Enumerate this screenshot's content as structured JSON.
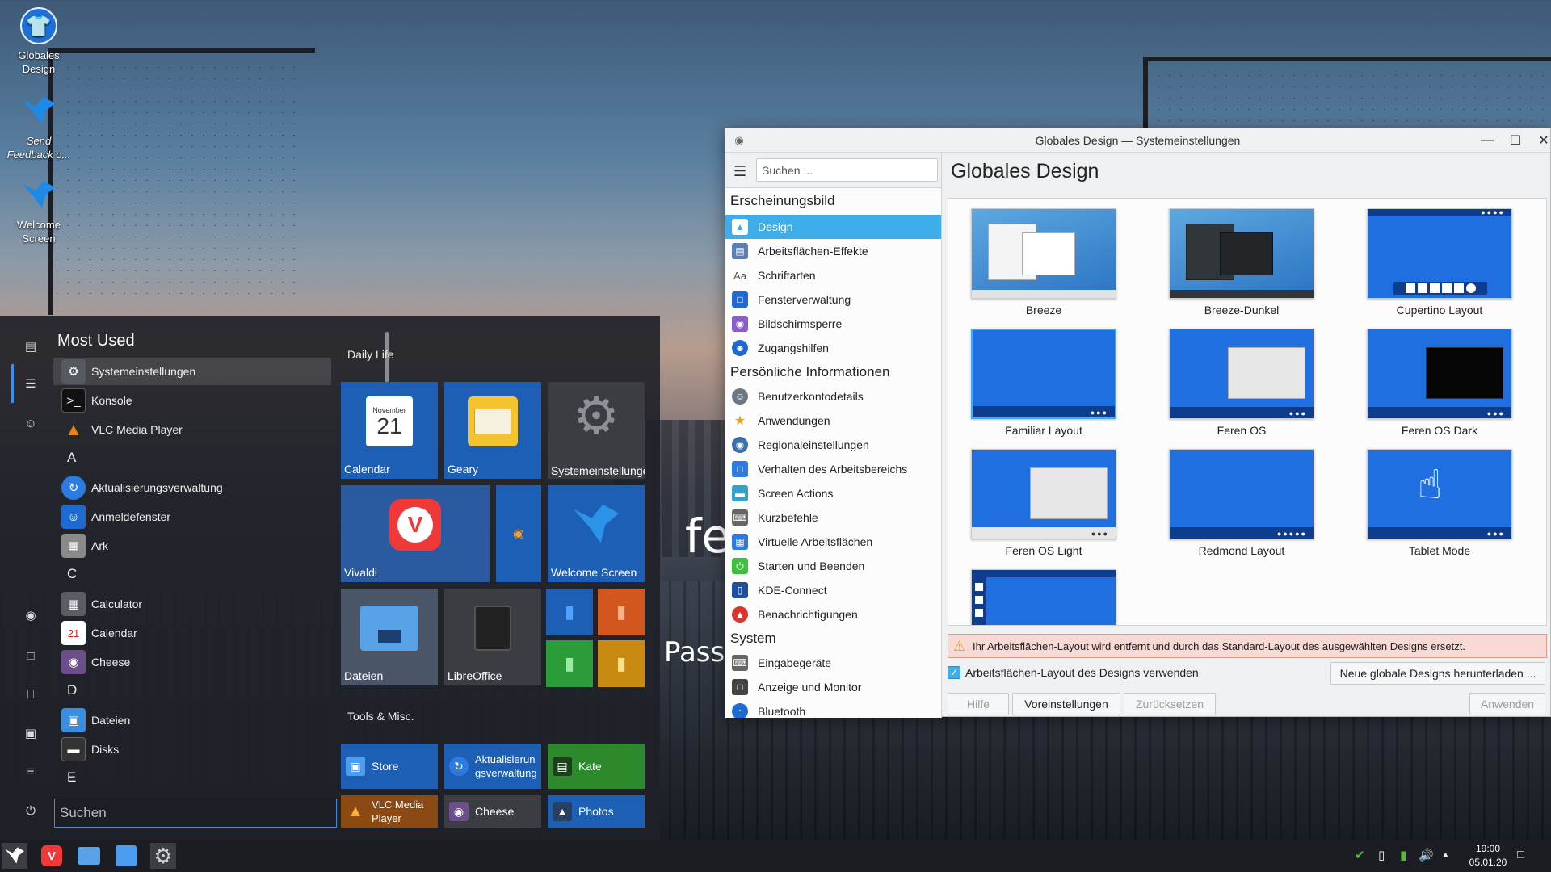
{
  "desktop": {
    "icons": [
      {
        "label": "Globales Design",
        "icon": "tshirt-icon"
      },
      {
        "label": "Send Feedback o...",
        "icon": "feren-bird-icon"
      },
      {
        "label": "Welcome Screen",
        "icon": "feren-bird-icon"
      }
    ],
    "wallpaper_text_1": "fe",
    "wallpaper_text_2": "Passio"
  },
  "start_menu": {
    "most_used_heading": "Most Used",
    "apps": [
      {
        "label": "Systemeinstellungen",
        "icon": "gear-icon",
        "color": "#555a60",
        "selected": true
      },
      {
        "label": "Konsole",
        "icon": "terminal-icon",
        "color": "#111111"
      },
      {
        "label": "VLC Media Player",
        "icon": "vlc-cone-icon",
        "color": "#e8820c"
      }
    ],
    "letter_a": "A",
    "apps_a": [
      {
        "label": "Aktualisierungsverwaltung",
        "icon": "refresh-icon",
        "color": "#2c7be0"
      },
      {
        "label": "Anmeldefenster",
        "icon": "login-icon",
        "color": "#1d6ad2"
      },
      {
        "label": "Ark",
        "icon": "archive-icon",
        "color": "#8a8a8a"
      }
    ],
    "letter_c": "C",
    "apps_c": [
      {
        "label": "Calculator",
        "icon": "calculator-icon",
        "color": "#5a5d61"
      },
      {
        "label": "Calendar",
        "icon": "calendar-icon",
        "color": "#ffffff"
      },
      {
        "label": "Cheese",
        "icon": "camera-icon",
        "color": "#6b4e8a"
      }
    ],
    "letter_d": "D",
    "apps_d": [
      {
        "label": "Dateien",
        "icon": "folder-icon",
        "color": "#3a8ee0"
      },
      {
        "label": "Disks",
        "icon": "disk-icon",
        "color": "#333333"
      }
    ],
    "letter_e": "E",
    "search_placeholder": "Suchen",
    "group_daily": "Daily Life",
    "group_tools": "Tools & Misc.",
    "tiles": {
      "calendar": {
        "label": "Calendar",
        "month": "November",
        "day": "21"
      },
      "geary": {
        "label": "Geary"
      },
      "systemeinstellungen": {
        "label": "Systemeinstellungen"
      },
      "vivaldi": {
        "label": "Vivaldi"
      },
      "welcome": {
        "label": "Welcome Screen"
      },
      "dateien": {
        "label": "Dateien"
      },
      "libreoffice": {
        "label": "LibreOffice"
      }
    },
    "wide_tiles": [
      {
        "label": "Store",
        "icon": "store-icon"
      },
      {
        "label": "Aktualisierungsverwaltung",
        "icon": "refresh-icon"
      },
      {
        "label": "Kate",
        "icon": "kate-icon"
      },
      {
        "label": "VLC Media Player",
        "icon": "vlc-cone-icon"
      },
      {
        "label": "Cheese",
        "icon": "camera-icon"
      },
      {
        "label": "Photos",
        "icon": "photos-icon"
      }
    ]
  },
  "settings_window": {
    "title": "Globales Design — Systemeinstellungen",
    "search_placeholder": "Suchen ...",
    "page_title": "Globales Design",
    "categories": {
      "appearance": "Erscheinungsbild",
      "personal": "Persönliche Informationen",
      "system": "System"
    },
    "appearance_items": [
      {
        "label": "Design",
        "icon": "tshirt-icon",
        "color": "#3daee9",
        "selected": true
      },
      {
        "label": "Arbeitsflächen-Effekte",
        "icon": "effects-icon",
        "color": "#5b7fb4"
      },
      {
        "label": "Schriftarten",
        "icon": "font-icon",
        "color": "#777777"
      },
      {
        "label": "Fensterverwaltung",
        "icon": "window-icon",
        "color": "#1d6ad2"
      },
      {
        "label": "Bildschirmsperre",
        "icon": "lock-icon",
        "color": "#8b5bd0"
      },
      {
        "label": "Zugangshilfen",
        "icon": "accessibility-icon",
        "color": "#1d6ad2"
      }
    ],
    "personal_items": [
      {
        "label": "Benutzerkontodetails",
        "icon": "user-icon",
        "color": "#6d7781"
      },
      {
        "label": "Anwendungen",
        "icon": "star-icon",
        "color": "#e8a317"
      },
      {
        "label": "Regionaleinstellungen",
        "icon": "globe-icon",
        "color": "#3a6fb0"
      },
      {
        "label": "Verhalten des Arbeitsbereichs",
        "icon": "desktop-icon",
        "color": "#2c7be0"
      },
      {
        "label": "Screen Actions",
        "icon": "screen-actions-icon",
        "color": "#33a1c9"
      },
      {
        "label": "Kurzbefehle",
        "icon": "keyboard-icon",
        "color": "#666666"
      },
      {
        "label": "Virtuelle Arbeitsflächen",
        "icon": "virtual-desktop-icon",
        "color": "#2c7be0"
      },
      {
        "label": "Starten und Beenden",
        "icon": "power-icon",
        "color": "#3fbf3f"
      },
      {
        "label": "KDE-Connect",
        "icon": "phone-icon",
        "color": "#1d4f9c"
      },
      {
        "label": "Benachrichtigungen",
        "icon": "bell-icon",
        "color": "#d9372e"
      }
    ],
    "system_items": [
      {
        "label": "Eingabegeräte",
        "icon": "keyboard-icon",
        "color": "#666666"
      },
      {
        "label": "Anzeige und Monitor",
        "icon": "monitor-icon",
        "color": "#444444"
      },
      {
        "label": "Bluetooth",
        "icon": "bluetooth-icon",
        "color": "#1d6ad2"
      }
    ],
    "themes": [
      {
        "name": "Breeze",
        "icon": "breeze-thumb"
      },
      {
        "name": "Breeze-Dunkel",
        "icon": "breeze-dark-thumb"
      },
      {
        "name": "Cupertino Layout",
        "icon": "cupertino-thumb"
      },
      {
        "name": "Familiar Layout",
        "icon": "familiar-thumb"
      },
      {
        "name": "Feren OS",
        "icon": "feren-thumb"
      },
      {
        "name": "Feren OS Dark",
        "icon": "feren-dark-thumb"
      },
      {
        "name": "Feren OS Light",
        "icon": "feren-light-thumb"
      },
      {
        "name": "Redmond Layout",
        "icon": "redmond-thumb"
      },
      {
        "name": "Tablet Mode",
        "icon": "tablet-thumb"
      }
    ],
    "warning": "Ihr Arbeitsflächen-Layout wird entfernt und durch das Standard-Layout des ausgewählten Designs ersetzt.",
    "use_layout_checkbox": {
      "label": "Arbeitsflächen-Layout des Designs verwenden",
      "checked": true
    },
    "download_button": "Neue globale Designs herunterladen ...",
    "buttons": {
      "help": "Hilfe",
      "defaults": "Voreinstellungen",
      "reset": "Zurücksetzen",
      "apply": "Anwenden"
    }
  },
  "taskbar": {
    "apps": [
      "feren-start-icon",
      "vivaldi-icon",
      "files-icon",
      "store-icon",
      "settings-icon"
    ],
    "clock_time": "19:00",
    "clock_date": "05.01.20"
  },
  "colors": {
    "accent": "#3daee9",
    "tile_blue": "#1d5fb4",
    "warning_bg": "#f9d9d3"
  }
}
